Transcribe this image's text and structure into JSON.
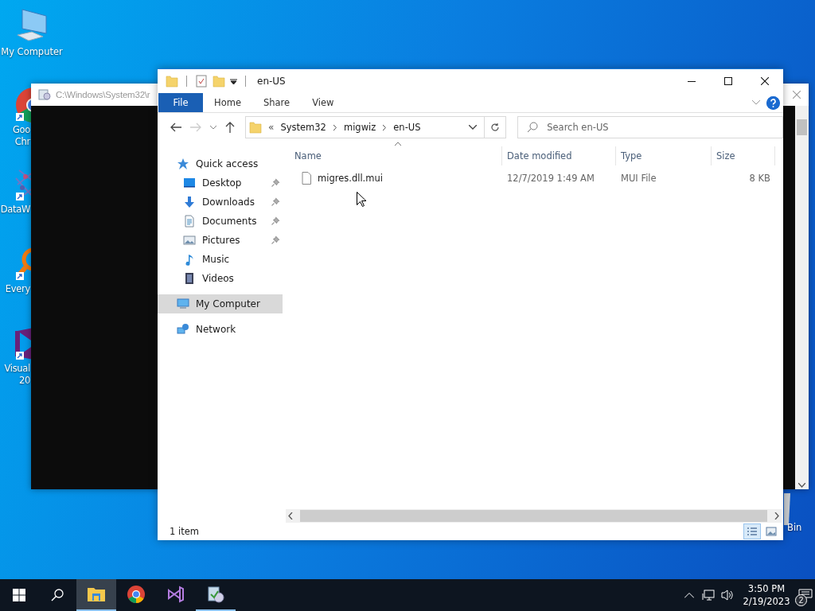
{
  "desktop_icons": [
    {
      "kind": "computer",
      "lines": [
        "My Computer"
      ]
    },
    {
      "kind": "chrome",
      "lines": [
        "Goo",
        "Chr"
      ]
    },
    {
      "kind": "molecule",
      "lines": [
        "DataW"
      ]
    },
    {
      "kind": "magnifier",
      "lines": [
        "Every"
      ]
    },
    {
      "kind": "vs",
      "lines": [
        "Visual",
        "20"
      ]
    },
    {
      "kind": "recycle",
      "lines": [
        "Bin"
      ]
    }
  ],
  "console": {
    "title": "C:\\Windows\\System32\\r"
  },
  "explorer": {
    "title": "en-US",
    "ribbon_tabs": [
      {
        "label": "File",
        "kind": "file"
      },
      {
        "label": "Home",
        "kind": "tab"
      },
      {
        "label": "Share",
        "kind": "tab"
      },
      {
        "label": "View",
        "kind": "tab"
      }
    ],
    "address": {
      "overflow": "«",
      "crumbs": [
        "System32",
        "migwiz",
        "en-US"
      ]
    },
    "search": {
      "placeholder": "Search en-US"
    },
    "sidebar": {
      "items": [
        {
          "label": "Quick access",
          "kind": "star",
          "selected": false,
          "children": [
            {
              "label": "Desktop",
              "kind": "desktop",
              "pinned": true,
              "selected": false
            },
            {
              "label": "Downloads",
              "kind": "download",
              "pinned": true,
              "selected": false
            },
            {
              "label": "Documents",
              "kind": "document",
              "pinned": true,
              "selected": false
            },
            {
              "label": "Pictures",
              "kind": "pictures",
              "pinned": true,
              "selected": false
            },
            {
              "label": "Music",
              "kind": "music",
              "pinned": false,
              "selected": false
            },
            {
              "label": "Videos",
              "kind": "videos",
              "pinned": false,
              "selected": false
            }
          ]
        },
        {
          "label": "My Computer",
          "kind": "computer",
          "selected": true
        },
        {
          "label": "Network",
          "kind": "network",
          "selected": false
        }
      ]
    },
    "table": {
      "columns": [
        "Name",
        "Date modified",
        "Type",
        "Size"
      ],
      "rows": [
        {
          "name": "migres.dll.mui",
          "date_modified": "12/7/2019 1:49 AM",
          "type": "MUI File",
          "size": "8 KB"
        }
      ]
    },
    "status_bar": {
      "count": "1 item",
      "views": [
        {
          "kind": "details",
          "selected": true
        },
        {
          "kind": "large",
          "selected": false
        }
      ]
    }
  },
  "taskbar": {
    "apps": [
      {
        "kind": "explorer",
        "active": true,
        "running": true
      },
      {
        "kind": "chrome",
        "active": false,
        "running": false
      },
      {
        "kind": "vs",
        "active": false,
        "running": false
      },
      {
        "kind": "installer",
        "active": false,
        "running": true
      }
    ],
    "clock": {
      "time": "3:50 PM",
      "date": "2/19/2023"
    },
    "notifications": "2"
  }
}
